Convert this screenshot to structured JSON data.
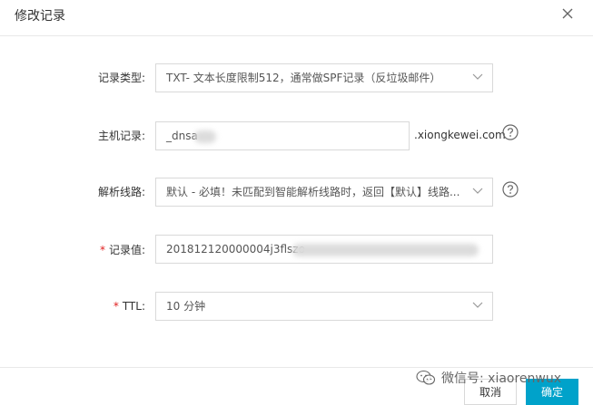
{
  "dialog": {
    "title": "修改记录",
    "close_icon": "close-icon"
  },
  "form": {
    "record_type": {
      "label": "记录类型:",
      "value": "TXT- 文本长度限制512，通常做SPF记录（反垃圾邮件）"
    },
    "host_record": {
      "label": "主机记录:",
      "value": "_dnsa",
      "suffix": ".xiongkewei.com"
    },
    "line": {
      "label": "解析线路:",
      "value": "默认 - 必填！未匹配到智能解析线路时，返回【默认】线路..."
    },
    "record_value": {
      "label": "记录值:",
      "required_mark": "*",
      "value": "201812120000004j3flszo"
    },
    "ttl": {
      "label": "TTL:",
      "required_mark": "*",
      "value": "10 分钟"
    }
  },
  "footer": {
    "watermark": "微信号: xiaorenwux",
    "cancel_label": "取消",
    "ok_label": "确定"
  },
  "colors": {
    "accent": "#00a2ca",
    "required": "#e02020"
  }
}
